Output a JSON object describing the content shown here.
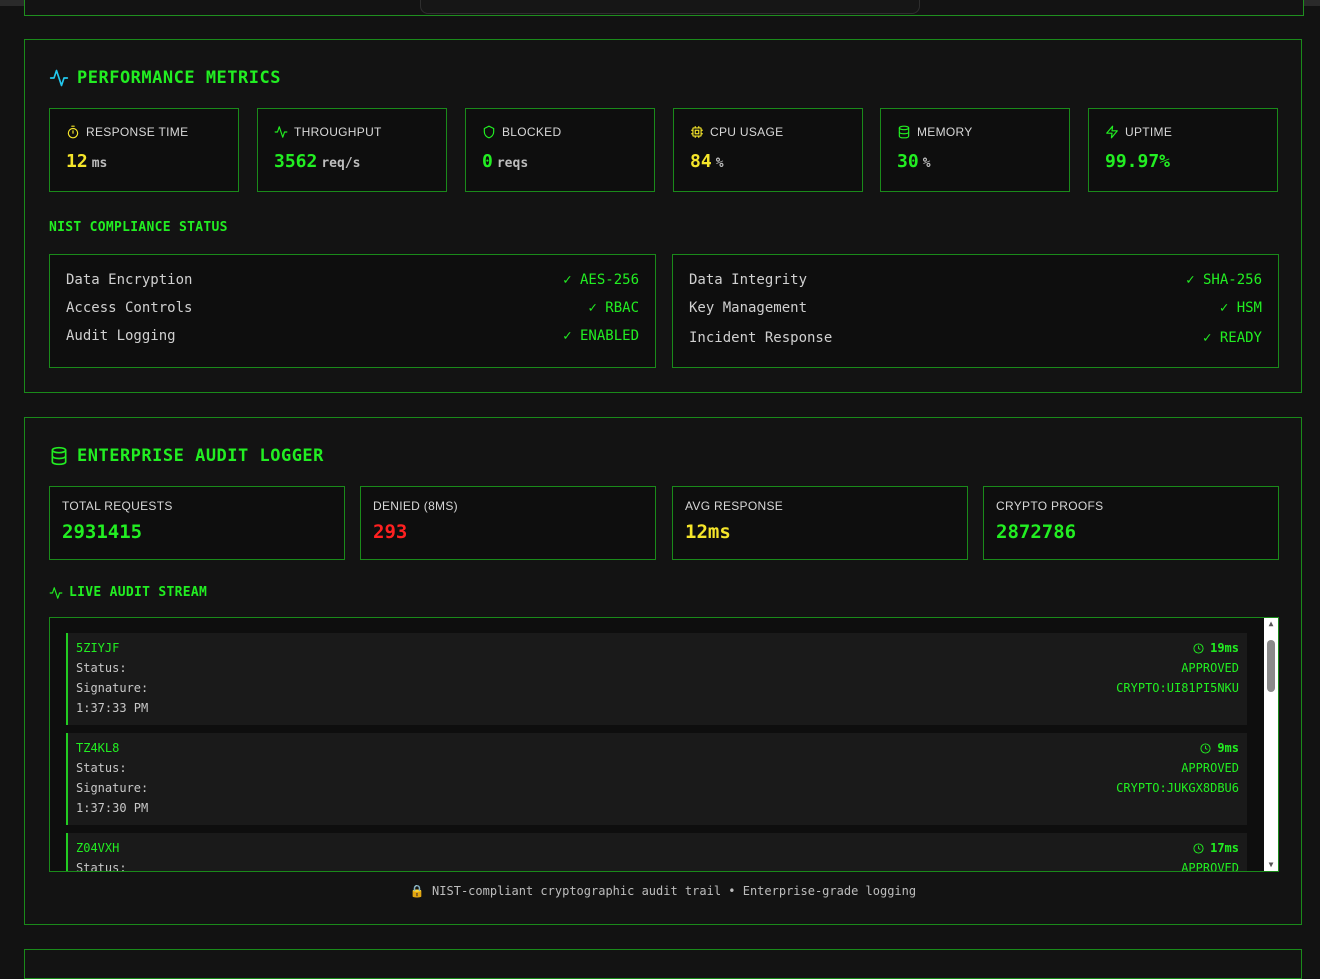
{
  "performance": {
    "title": "PERFORMANCE METRICS",
    "metrics": [
      {
        "label": "RESPONSE TIME",
        "value": "12",
        "unit": "ms",
        "icon": "timer-icon",
        "color": "#f5e52a"
      },
      {
        "label": "THROUGHPUT",
        "value": "3562",
        "unit": "req/s",
        "icon": "activity-icon",
        "color": "#22ee22"
      },
      {
        "label": "BLOCKED",
        "value": "0",
        "unit": "reqs",
        "icon": "shield-icon",
        "color": "#22ee22"
      },
      {
        "label": "CPU USAGE",
        "value": "84",
        "unit": "%",
        "icon": "cpu-icon",
        "color": "#f5e52a"
      },
      {
        "label": "MEMORY",
        "value": "30",
        "unit": "%",
        "icon": "database-icon",
        "color": "#22ee22"
      },
      {
        "label": "UPTIME",
        "value": "99.97%",
        "unit": "",
        "icon": "zap-icon",
        "color": "#22ee22"
      }
    ],
    "compliance_heading": "NIST COMPLIANCE STATUS",
    "compliance_left": [
      {
        "name": "Data Encryption",
        "status": "✓ AES-256"
      },
      {
        "name": "Access Controls",
        "status": "✓ RBAC"
      },
      {
        "name": "Audit Logging",
        "status": "✓ ENABLED"
      }
    ],
    "compliance_right": [
      {
        "name": "Data Integrity",
        "status": "✓ SHA-256"
      },
      {
        "name": "Key Management",
        "status": "✓ HSM"
      },
      {
        "name": "Incident Response",
        "status": "✓ READY"
      }
    ]
  },
  "audit": {
    "title": "ENTERPRISE AUDIT LOGGER",
    "stats": [
      {
        "label": "TOTAL REQUESTS",
        "value": "2931415",
        "color": "#22ee22"
      },
      {
        "label": "DENIED (8MS)",
        "value": "293",
        "color": "#ff2020"
      },
      {
        "label": "AVG RESPONSE",
        "value": "12ms",
        "color": "#f5e52a"
      },
      {
        "label": "CRYPTO PROOFS",
        "value": "2872786",
        "color": "#22ee22"
      }
    ],
    "stream_heading": "LIVE AUDIT STREAM",
    "status_label": "Status:",
    "signature_label": "Signature:",
    "entries": [
      {
        "id": "5ZIYJF",
        "time": "1:37:33 PM",
        "ms": "19ms",
        "status": "APPROVED",
        "signature": "CRYPTO:UI81PI5NKU"
      },
      {
        "id": "TZ4KL8",
        "time": "1:37:30 PM",
        "ms": "9ms",
        "status": "APPROVED",
        "signature": "CRYPTO:JUKGX8DBU6"
      },
      {
        "id": "Z04VXH",
        "time": "",
        "ms": "17ms",
        "status": "APPROVED",
        "signature": ""
      }
    ],
    "footer": "🔒 NIST-compliant cryptographic audit trail • Enterprise-grade logging"
  }
}
